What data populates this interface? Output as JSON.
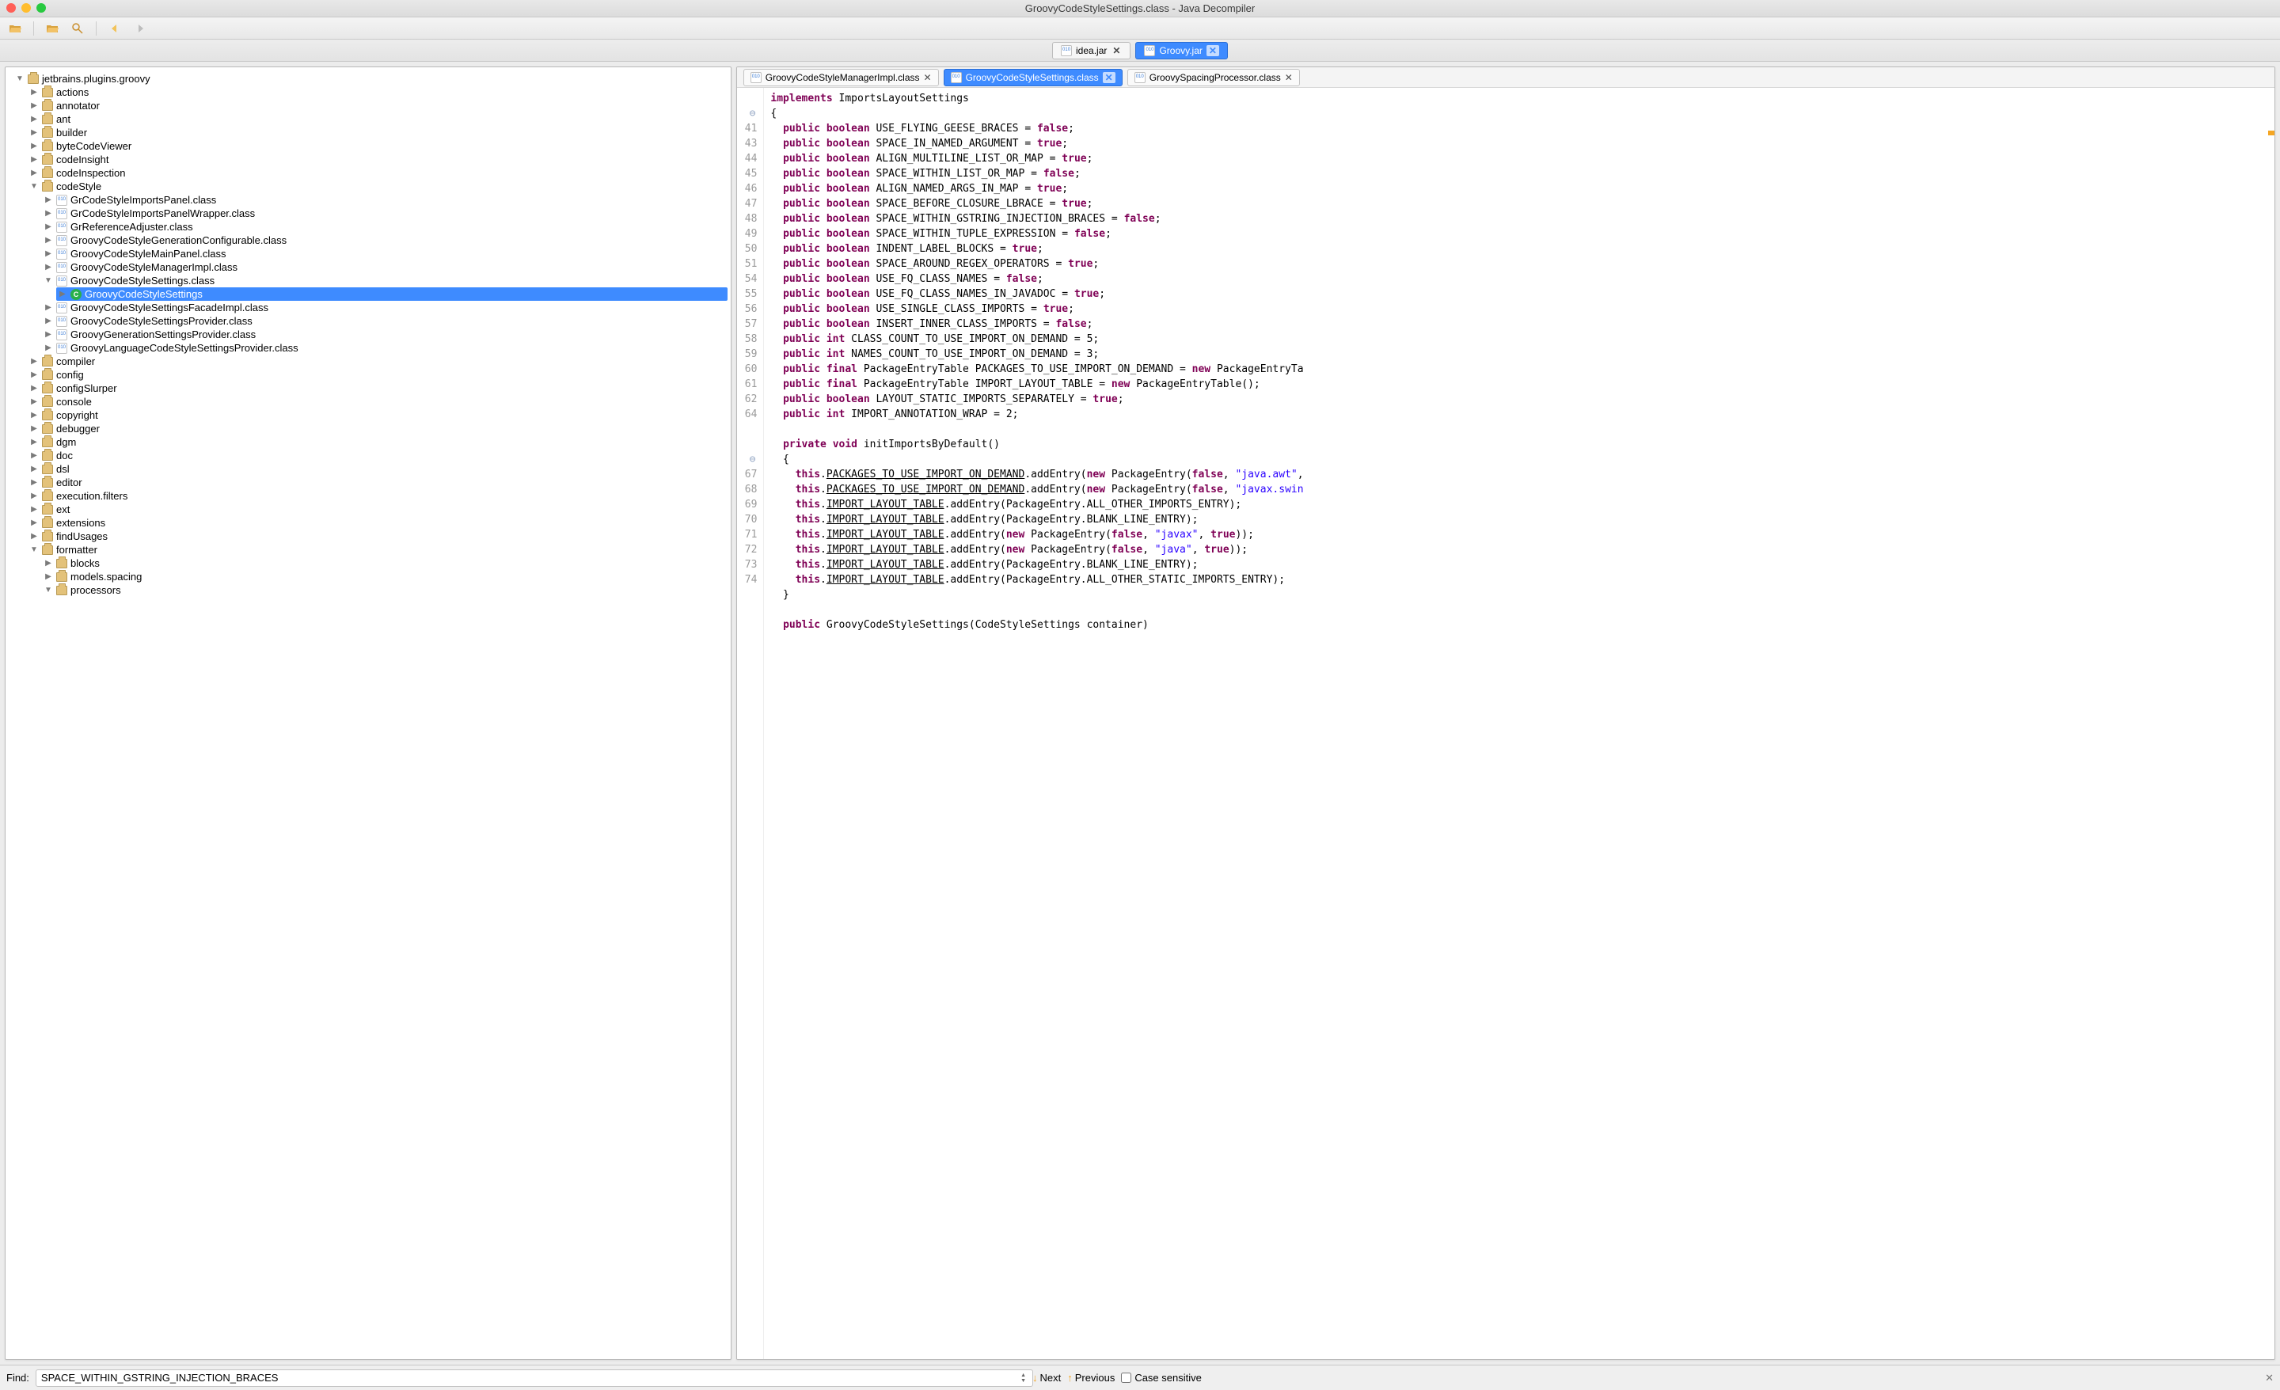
{
  "window": {
    "title": "GroovyCodeStyleSettings.class - Java Decompiler"
  },
  "file_tabs": [
    {
      "label": "idea.jar",
      "active": false
    },
    {
      "label": "Groovy.jar",
      "active": true
    }
  ],
  "editor_tabs": [
    {
      "label": "GroovyCodeStyleManagerImpl.class",
      "active": false
    },
    {
      "label": "GroovyCodeStyleSettings.class",
      "active": true
    },
    {
      "label": "GroovySpacingProcessor.class",
      "active": false
    }
  ],
  "tree": {
    "root": "jetbrains.plugins.groovy",
    "packages_top": [
      "actions",
      "annotator",
      "ant",
      "builder",
      "byteCodeViewer",
      "codeInsight",
      "codeInspection"
    ],
    "codeStyle": {
      "label": "codeStyle",
      "classes_before": [
        "GrCodeStyleImportsPanel.class",
        "GrCodeStyleImportsPanelWrapper.class",
        "GrReferenceAdjuster.class",
        "GroovyCodeStyleGenerationConfigurable.class",
        "GroovyCodeStyleMainPanel.class",
        "GroovyCodeStyleManagerImpl.class"
      ],
      "selected_class_file": "GroovyCodeStyleSettings.class",
      "selected_inner": "GroovyCodeStyleSettings",
      "classes_after": [
        "GroovyCodeStyleSettingsFacadeImpl.class",
        "GroovyCodeStyleSettingsProvider.class",
        "GroovyGenerationSettingsProvider.class",
        "GroovyLanguageCodeStyleSettingsProvider.class"
      ]
    },
    "packages_mid": [
      "compiler",
      "config",
      "configSlurper",
      "console",
      "copyright",
      "debugger",
      "dgm",
      "doc",
      "dsl",
      "editor",
      "execution.filters",
      "ext",
      "extensions",
      "findUsages"
    ],
    "formatter": {
      "label": "formatter",
      "children": [
        "blocks",
        "models.spacing"
      ],
      "processors": "processors"
    }
  },
  "code": {
    "header": [
      "implements",
      " ImportsLayoutSettings"
    ],
    "brace": "{",
    "lines": [
      {
        "n": 41,
        "t": [
          "public",
          " ",
          "boolean",
          " USE_FLYING_GEESE_BRACES = ",
          "false",
          ";"
        ],
        "k": [
          0,
          2,
          4
        ]
      },
      {
        "n": 43,
        "t": [
          "public",
          " ",
          "boolean",
          " SPACE_IN_NAMED_ARGUMENT = ",
          "true",
          ";"
        ],
        "k": [
          0,
          2,
          4
        ]
      },
      {
        "n": 44,
        "t": [
          "public",
          " ",
          "boolean",
          " ALIGN_MULTILINE_LIST_OR_MAP = ",
          "true",
          ";"
        ],
        "k": [
          0,
          2,
          4
        ]
      },
      {
        "n": 45,
        "t": [
          "public",
          " ",
          "boolean",
          " SPACE_WITHIN_LIST_OR_MAP = ",
          "false",
          ";"
        ],
        "k": [
          0,
          2,
          4
        ]
      },
      {
        "n": 46,
        "t": [
          "public",
          " ",
          "boolean",
          " ALIGN_NAMED_ARGS_IN_MAP = ",
          "true",
          ";"
        ],
        "k": [
          0,
          2,
          4
        ]
      },
      {
        "n": 47,
        "t": [
          "public",
          " ",
          "boolean",
          " SPACE_BEFORE_CLOSURE_LBRACE = ",
          "true",
          ";"
        ],
        "k": [
          0,
          2,
          4
        ]
      },
      {
        "n": 48,
        "t": [
          "public",
          " ",
          "boolean",
          " SPACE_WITHIN_GSTRING_INJECTION_BRACES = ",
          "false",
          ";"
        ],
        "k": [
          0,
          2,
          4
        ]
      },
      {
        "n": 49,
        "t": [
          "public",
          " ",
          "boolean",
          " SPACE_WITHIN_TUPLE_EXPRESSION = ",
          "false",
          ";"
        ],
        "k": [
          0,
          2,
          4
        ]
      },
      {
        "n": 50,
        "t": [
          "public",
          " ",
          "boolean",
          " INDENT_LABEL_BLOCKS = ",
          "true",
          ";"
        ],
        "k": [
          0,
          2,
          4
        ]
      },
      {
        "n": 51,
        "t": [
          "public",
          " ",
          "boolean",
          " SPACE_AROUND_REGEX_OPERATORS = ",
          "true",
          ";"
        ],
        "k": [
          0,
          2,
          4
        ]
      },
      {
        "n": 54,
        "t": [
          "public",
          " ",
          "boolean",
          " USE_FQ_CLASS_NAMES = ",
          "false",
          ";"
        ],
        "k": [
          0,
          2,
          4
        ]
      },
      {
        "n": 55,
        "t": [
          "public",
          " ",
          "boolean",
          " USE_FQ_CLASS_NAMES_IN_JAVADOC = ",
          "true",
          ";"
        ],
        "k": [
          0,
          2,
          4
        ]
      },
      {
        "n": 56,
        "t": [
          "public",
          " ",
          "boolean",
          " USE_SINGLE_CLASS_IMPORTS = ",
          "true",
          ";"
        ],
        "k": [
          0,
          2,
          4
        ]
      },
      {
        "n": 57,
        "t": [
          "public",
          " ",
          "boolean",
          " INSERT_INNER_CLASS_IMPORTS = ",
          "false",
          ";"
        ],
        "k": [
          0,
          2,
          4
        ]
      },
      {
        "n": 58,
        "t": [
          "public",
          " ",
          "int",
          " CLASS_COUNT_TO_USE_IMPORT_ON_DEMAND = 5;"
        ],
        "k": [
          0,
          2
        ]
      },
      {
        "n": 59,
        "t": [
          "public",
          " ",
          "int",
          " NAMES_COUNT_TO_USE_IMPORT_ON_DEMAND = 3;"
        ],
        "k": [
          0,
          2
        ]
      },
      {
        "n": 60,
        "t": [
          "public",
          " ",
          "final",
          " PackageEntryTable PACKAGES_TO_USE_IMPORT_ON_DEMAND = ",
          "new",
          " PackageEntryTa"
        ],
        "k": [
          0,
          2,
          4
        ]
      },
      {
        "n": 61,
        "t": [
          "public",
          " ",
          "final",
          " PackageEntryTable IMPORT_LAYOUT_TABLE = ",
          "new",
          " PackageEntryTable();"
        ],
        "k": [
          0,
          2,
          4
        ]
      },
      {
        "n": 62,
        "t": [
          "public",
          " ",
          "boolean",
          " LAYOUT_STATIC_IMPORTS_SEPARATELY = ",
          "true",
          ";"
        ],
        "k": [
          0,
          2,
          4
        ]
      },
      {
        "n": 64,
        "t": [
          "public",
          " ",
          "int",
          " IMPORT_ANNOTATION_WRAP = 2;"
        ],
        "k": [
          0,
          2
        ]
      }
    ],
    "method_sig": [
      "private",
      " ",
      "void",
      " initImportsByDefault()"
    ],
    "method_body": [
      {
        "n": 67,
        "pre": "  ",
        "this": "this",
        "dot": ".",
        "field": "PACKAGES_TO_USE_IMPORT_ON_DEMAND",
        "rest": [
          ".addEntry(",
          "new",
          " PackageEntry(",
          "false",
          ", ",
          "\"java.awt\"",
          ","
        ],
        "k": [
          1,
          3
        ],
        "s": [
          5
        ]
      },
      {
        "n": 68,
        "pre": "  ",
        "this": "this",
        "dot": ".",
        "field": "PACKAGES_TO_USE_IMPORT_ON_DEMAND",
        "rest": [
          ".addEntry(",
          "new",
          " PackageEntry(",
          "false",
          ", ",
          "\"javax.swin"
        ],
        "k": [
          1,
          3
        ],
        "s": [
          5
        ]
      },
      {
        "n": 69,
        "pre": "  ",
        "this": "this",
        "dot": ".",
        "field": "IMPORT_LAYOUT_TABLE",
        "rest": [
          ".addEntry(PackageEntry.ALL_OTHER_IMPORTS_ENTRY);"
        ],
        "k": [],
        "s": []
      },
      {
        "n": 70,
        "pre": "  ",
        "this": "this",
        "dot": ".",
        "field": "IMPORT_LAYOUT_TABLE",
        "rest": [
          ".addEntry(PackageEntry.BLANK_LINE_ENTRY);"
        ],
        "k": [],
        "s": []
      },
      {
        "n": 71,
        "pre": "  ",
        "this": "this",
        "dot": ".",
        "field": "IMPORT_LAYOUT_TABLE",
        "rest": [
          ".addEntry(",
          "new",
          " PackageEntry(",
          "false",
          ", ",
          "\"javax\"",
          ", ",
          "true",
          "));"
        ],
        "k": [
          1,
          3,
          7
        ],
        "s": [
          5
        ]
      },
      {
        "n": 72,
        "pre": "  ",
        "this": "this",
        "dot": ".",
        "field": "IMPORT_LAYOUT_TABLE",
        "rest": [
          ".addEntry(",
          "new",
          " PackageEntry(",
          "false",
          ", ",
          "\"java\"",
          ", ",
          "true",
          "));"
        ],
        "k": [
          1,
          3,
          7
        ],
        "s": [
          5
        ]
      },
      {
        "n": 73,
        "pre": "  ",
        "this": "this",
        "dot": ".",
        "field": "IMPORT_LAYOUT_TABLE",
        "rest": [
          ".addEntry(PackageEntry.BLANK_LINE_ENTRY);"
        ],
        "k": [],
        "s": []
      },
      {
        "n": 74,
        "pre": "  ",
        "this": "this",
        "dot": ".",
        "field": "IMPORT_LAYOUT_TABLE",
        "rest": [
          ".addEntry(PackageEntry.ALL_OTHER_STATIC_IMPORTS_ENTRY);"
        ],
        "k": [],
        "s": []
      }
    ],
    "close_brace": "}",
    "ctor": [
      "public",
      " GroovyCodeStyleSettings(CodeStyleSettings container)"
    ]
  },
  "find": {
    "label": "Find:",
    "value": "SPACE_WITHIN_GSTRING_INJECTION_BRACES",
    "next": "Next",
    "prev": "Previous",
    "case": "Case sensitive"
  }
}
